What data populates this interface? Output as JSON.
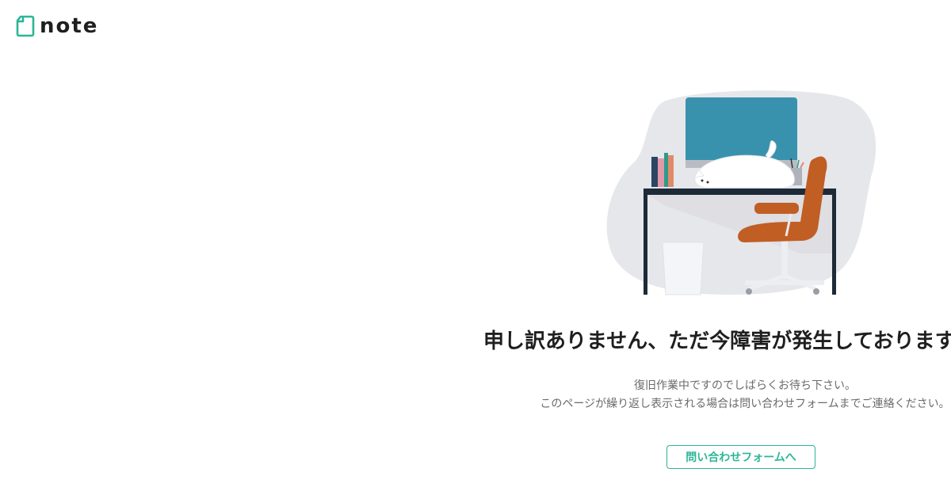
{
  "header": {
    "logo_text": "note",
    "logo_icon": "note-logo-icon"
  },
  "error": {
    "headline": "申し訳ありません、ただ今障害が発生しております",
    "line1": "復旧作業中ですのでしばらくお待ち下さい。",
    "line2": "このページが繰り返し表示される場合は問い合わせフォームまでご連絡ください。"
  },
  "actions": {
    "contact_label": "問い合わせフォームへ"
  },
  "colors": {
    "brand": "#2cb696",
    "monitor": "#3892ad",
    "chair": "#c05e24",
    "blob": "#e6e7eb",
    "text": "#1f1f1f",
    "subtext": "#6b6b6b"
  }
}
